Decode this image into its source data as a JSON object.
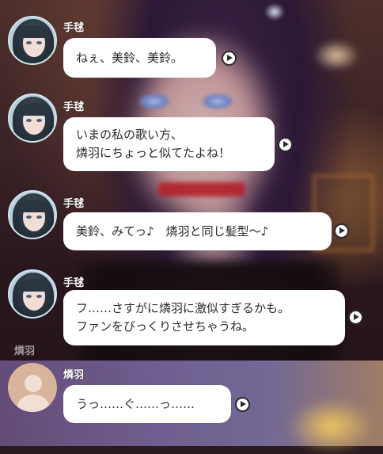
{
  "section_label": "燐羽",
  "messages": [
    {
      "sender": "手毬",
      "lines": [
        "ねぇ、美鈴、美鈴。"
      ]
    },
    {
      "sender": "手毬",
      "lines": [
        "いまの私の歌い方、",
        "燐羽にちょっと似てたよね！"
      ]
    },
    {
      "sender": "手毬",
      "lines": [
        "美鈴、みてっ♪　燐羽と同じ髪型～♪"
      ]
    },
    {
      "sender": "手毬",
      "lines": [
        "フ……さすがに燐羽に激似すぎるかも。",
        "ファンをびっくりさせちゃうね。"
      ]
    }
  ],
  "player": {
    "sender": "燐羽",
    "lines": [
      "うっ……ぐ……っ……"
    ]
  },
  "icons": {
    "avatar_npc": "character-portrait",
    "avatar_player": "default-user-silhouette",
    "voice": "play-voice-icon"
  },
  "colors": {
    "bubble": "#ffffff",
    "text": "#2b2b2b",
    "name": "#ffffff",
    "panel": "#8c78b9"
  }
}
